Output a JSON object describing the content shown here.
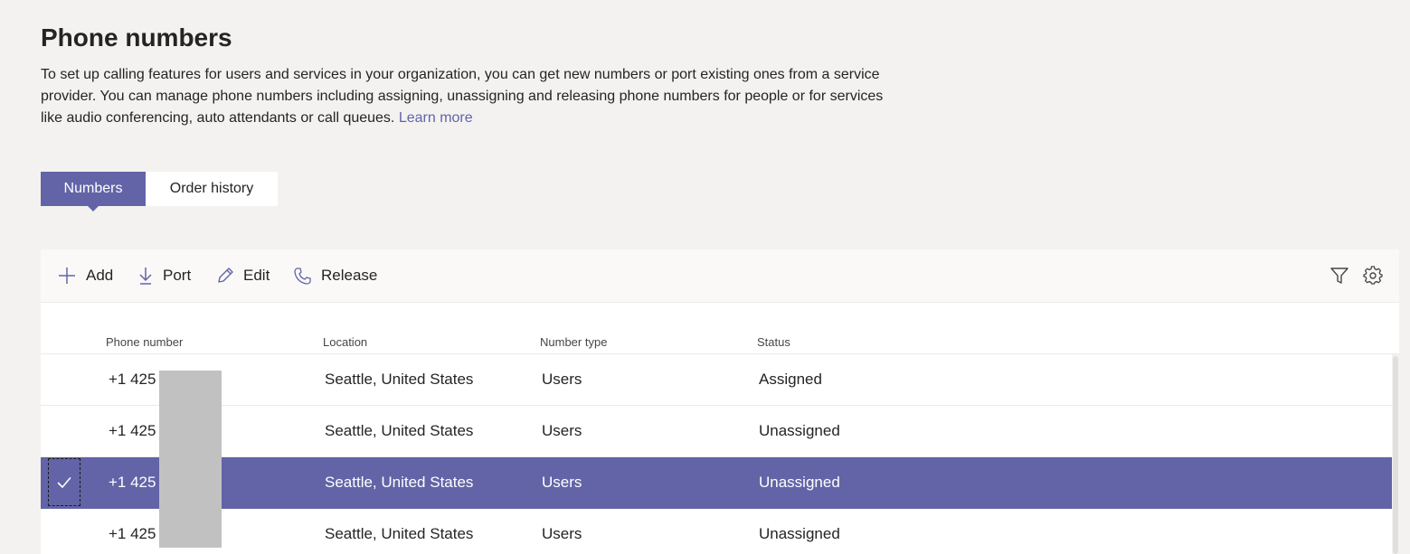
{
  "page": {
    "title": "Phone numbers",
    "description": "To set up calling features for users and services in your organization, you can get new numbers or port existing ones from a service provider. You can manage phone numbers including assigning, unassigning and releasing phone numbers for people or for services like audio conferencing, auto attendants or call queues.",
    "learn_more": "Learn more"
  },
  "tabs": [
    {
      "label": "Numbers",
      "active": true
    },
    {
      "label": "Order history",
      "active": false
    }
  ],
  "toolbar": {
    "add_label": "Add",
    "port_label": "Port",
    "edit_label": "Edit",
    "release_label": "Release",
    "icons": [
      "plus-icon",
      "download-icon",
      "pencil-icon",
      "phone-icon",
      "filter-icon",
      "gear-icon"
    ]
  },
  "table": {
    "columns": [
      "Phone number",
      "Location",
      "Number type",
      "Status"
    ],
    "rows": [
      {
        "phone": "+1 425",
        "location": "Seattle, United States",
        "type": "Users",
        "status": "Assigned",
        "selected": false
      },
      {
        "phone": "+1 425",
        "location": "Seattle, United States",
        "type": "Users",
        "status": "Unassigned",
        "selected": false
      },
      {
        "phone": "+1 425",
        "location": "Seattle, United States",
        "type": "Users",
        "status": "Unassigned",
        "selected": true
      },
      {
        "phone": "+1 425",
        "location": "Seattle, United States",
        "type": "Users",
        "status": "Unassigned",
        "selected": false
      }
    ]
  },
  "colors": {
    "accent": "#6264a7",
    "background": "#f3f2f1",
    "panel": "#ffffff",
    "redaction": "#c1c1c1"
  }
}
